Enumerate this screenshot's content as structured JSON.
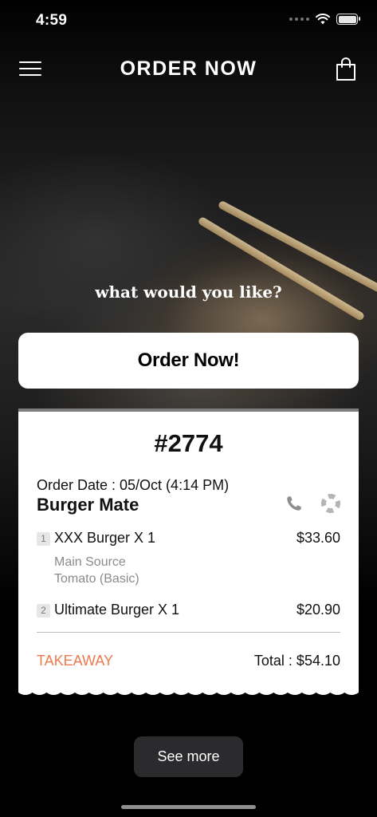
{
  "status_bar": {
    "time": "4:59"
  },
  "nav": {
    "title": "ORDER NOW"
  },
  "hero": {
    "tagline": "what would you like?",
    "cta_label": "Order Now!"
  },
  "receipt": {
    "order_number": "#2774",
    "order_date": "Order Date : 05/Oct (4:14 PM)",
    "restaurant": "Burger Mate",
    "items": [
      {
        "index": "1",
        "name": "XXX Burger X 1",
        "price": "$33.60",
        "details": [
          "Main Source",
          "Tomato (Basic)"
        ]
      },
      {
        "index": "2",
        "name": "Ultimate Burger X 1",
        "price": "$20.90",
        "details": []
      }
    ],
    "order_type": "TAKEAWAY",
    "total": "Total : $54.10"
  },
  "see_more_label": "See more",
  "colors": {
    "accent": "#ee7a50",
    "background": "#000000",
    "card": "#ffffff",
    "button_dark": "#2b2b2d"
  },
  "icons": [
    "menu-icon",
    "shopping-bag-icon",
    "phone-icon",
    "support-icon",
    "wifi-icon",
    "battery-icon",
    "signal-icon"
  ]
}
